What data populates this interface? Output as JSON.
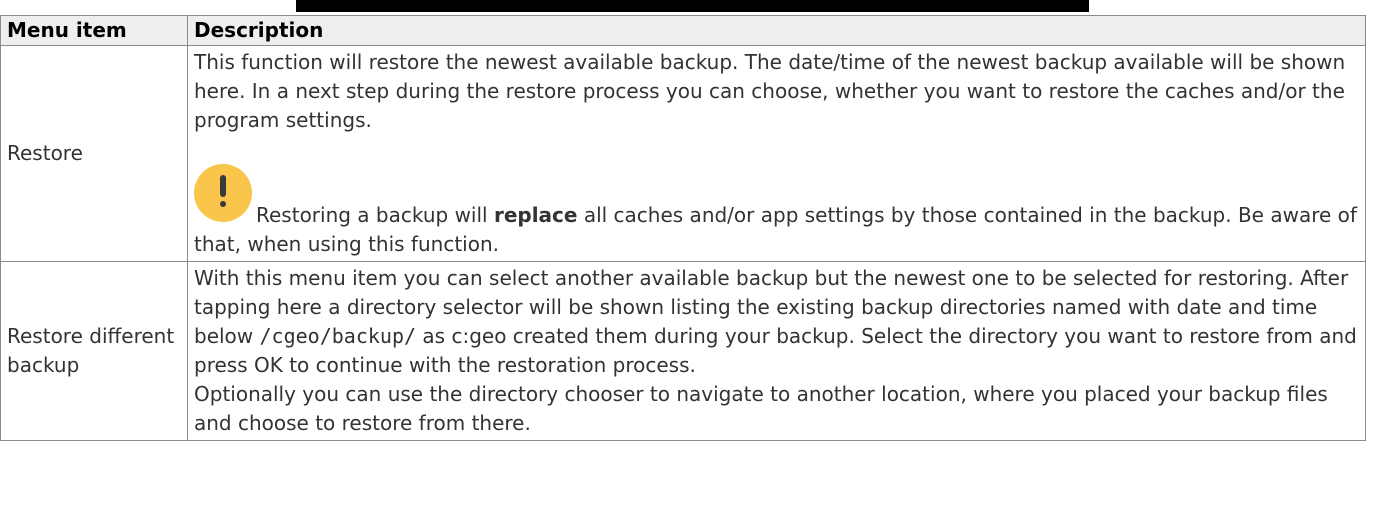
{
  "table": {
    "headers": {
      "item": "Menu item",
      "description": "Description"
    },
    "rows": [
      {
        "item": "Restore",
        "paragraph": "This function will restore the newest available backup. The date/time of the newest backup available will be shown here. In a next step during the restore process you can choose, whether you want to restore the caches and/or the program settings.",
        "note": {
          "icon": "exclamation-icon",
          "before": "Restoring a backup will ",
          "strong": "replace",
          "after": " all caches and/or app settings by those contained in the backup. Be aware of that, when using this function."
        }
      },
      {
        "item": "Restore different backup",
        "paragraph_before_code": "With this menu item you can select another available backup but the newest one to be selected for restoring. After tapping here a directory selector will be shown listing the existing backup directories named with date and time below ",
        "code": "/cgeo/backup/",
        "paragraph_after_code": " as c:geo created them during your backup. Select the directory you want to restore from and press OK to continue with the restoration process.",
        "paragraph2": "Optionally you can use the directory chooser to navigate to another location, where you placed your backup files and choose to restore from there."
      }
    ]
  }
}
